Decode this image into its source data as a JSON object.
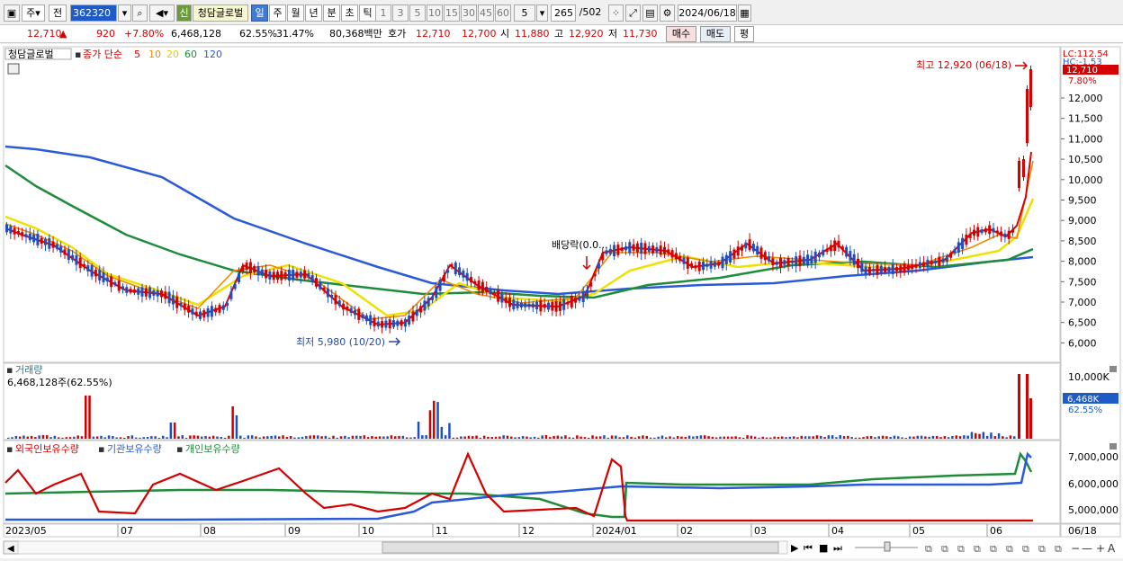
{
  "toolbar": {
    "type1": "주",
    "type2": "전",
    "code": "362320",
    "new_badge": "신",
    "name": "청담글로벌",
    "periods": [
      "일",
      "주",
      "월",
      "년",
      "분",
      "초",
      "틱"
    ],
    "intervals": [
      "1",
      "3",
      "5",
      "10",
      "15",
      "30",
      "45",
      "60"
    ],
    "interval_value": "5",
    "count": "265",
    "count_total": "/502",
    "date": "2024/06/18"
  },
  "quote": {
    "price": "12,710",
    "arrow": "▲",
    "change": "920",
    "change_pct": "+7.80%",
    "volume": "6,468,128",
    "vol_ratio": "62.55%",
    "turnover": "31.47%",
    "amount": "80,368백만",
    "ask_label": "호가",
    "ask": "12,710",
    "bid": "12,700",
    "open_label": "시",
    "open": "11,880",
    "high_label": "고",
    "high": "12,920",
    "low_label": "저",
    "low": "11,730",
    "buy_label": "매수",
    "sell_label": "매도",
    "eval_label": "평"
  },
  "price_panel": {
    "name_tag": "청담글로벌",
    "ma_label": "종가 단순",
    "ma_periods": [
      "5",
      "10",
      "20",
      "60",
      "120"
    ],
    "ma_colors": [
      "#e00000",
      "#f08a00",
      "#f0e000",
      "#1e8c3a",
      "#2a5ad8"
    ],
    "lc_label": "LC:112.54",
    "hc_label": "HC:-1.53",
    "last_price": "12,710",
    "last_pct": "7.80%",
    "y_ticks": [
      "12,000",
      "11,500",
      "11,000",
      "10,500",
      "10,000",
      "9,500",
      "9,000",
      "8,500",
      "8,000",
      "7,500",
      "7,000",
      "6,500",
      "6,000"
    ],
    "high_note": "최고 12,920 (06/18)",
    "low_note": "최저 5,980 (10/20)",
    "dividend_note": "배당락(0.0..."
  },
  "volume_panel": {
    "title": "거래량",
    "value": "6,468,128주(62.55%)",
    "y_tick": "10,000K",
    "last": "6,468K",
    "last_pct": "62.55%"
  },
  "holding_panel": {
    "labels": [
      "외국인보유수량",
      "기관보유수량",
      "개인보유수량"
    ],
    "colors": [
      "#d40000",
      "#2a5ad8",
      "#1e8c3a"
    ],
    "y_ticks": [
      "7,000,000",
      "6,000,000",
      "5,000,000"
    ]
  },
  "x_axis": {
    "labels": [
      "2023/05",
      "07",
      "08",
      "09",
      "10",
      "11",
      "12",
      "2024/01",
      "02",
      "03",
      "04",
      "05",
      "06"
    ],
    "last": "06/18"
  }
}
